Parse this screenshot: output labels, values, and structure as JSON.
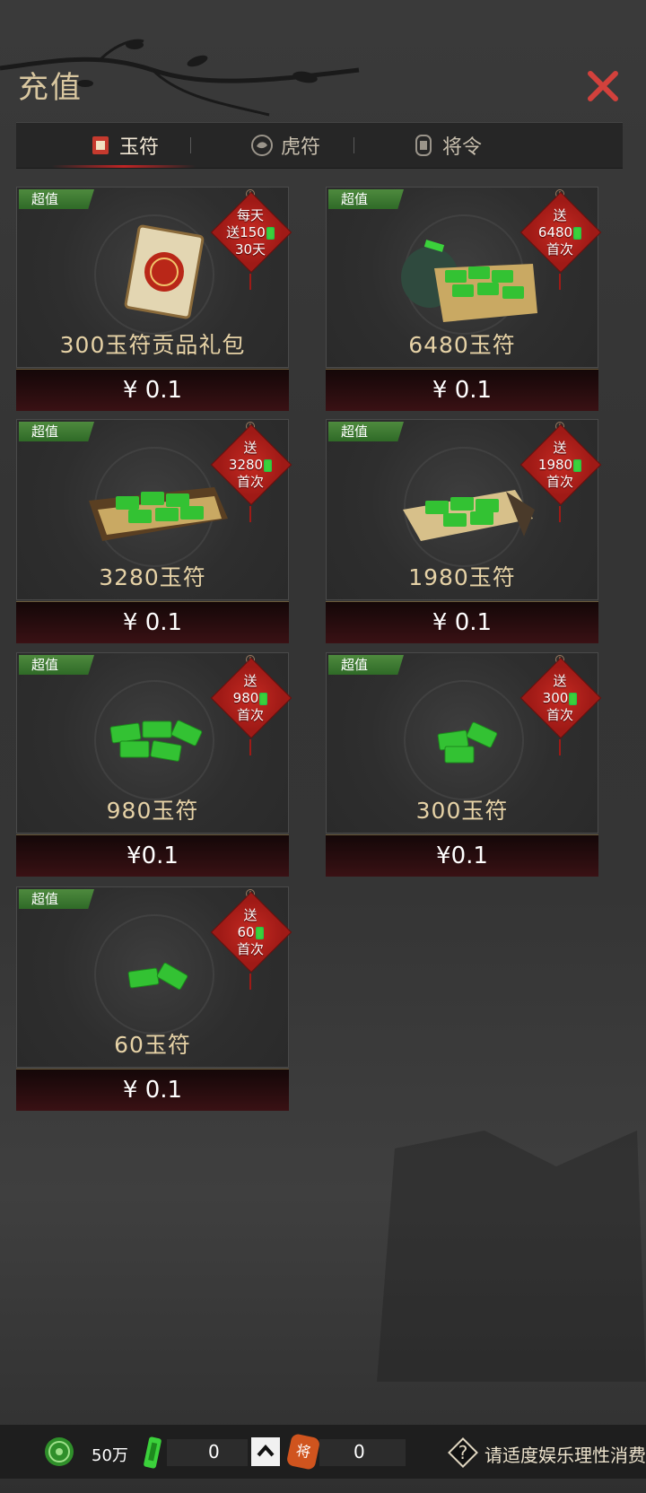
{
  "header": {
    "title": "充值"
  },
  "tabs": [
    {
      "label": "玉符",
      "icon": "jade-seal-icon",
      "active": true
    },
    {
      "label": "虎符",
      "icon": "tiger-tally-icon",
      "active": false
    },
    {
      "label": "将令",
      "icon": "general-order-icon",
      "active": false
    }
  ],
  "products": [
    {
      "badge": "超值",
      "tag_lines": [
        "每天",
        "送150",
        "30天"
      ],
      "name": "300玉符贡品礼包",
      "price": "¥ 0.1"
    },
    {
      "badge": "超值",
      "tag_lines": [
        "送",
        "6480",
        "首次"
      ],
      "name": "6480玉符",
      "price": "¥ 0.1"
    },
    {
      "badge": "超值",
      "tag_lines": [
        "送",
        "3280",
        "首次"
      ],
      "name": "3280玉符",
      "price": "¥ 0.1"
    },
    {
      "badge": "超值",
      "tag_lines": [
        "送",
        "1980",
        "首次"
      ],
      "name": "1980玉符",
      "price": "¥ 0.1"
    },
    {
      "badge": "超值",
      "tag_lines": [
        "送",
        "980",
        "首次"
      ],
      "name": "980玉符",
      "price": "¥0.1"
    },
    {
      "badge": "超值",
      "tag_lines": [
        "送",
        "300",
        "首次"
      ],
      "name": "300玉符",
      "price": "¥0.1"
    },
    {
      "badge": "超值",
      "tag_lines": [
        "送",
        "60",
        "首次"
      ],
      "name": "60玉符",
      "price": "¥ 0.1"
    }
  ],
  "bottom_bar": {
    "coin_amount": "50万",
    "jade_amount": "0",
    "order_amount": "0",
    "order_icon_text": "将",
    "notice": "请适度娱乐理性消费"
  },
  "colors": {
    "accent_red": "#c02525",
    "badge_green": "#3f7f33",
    "jade_green": "#3bd13b"
  }
}
